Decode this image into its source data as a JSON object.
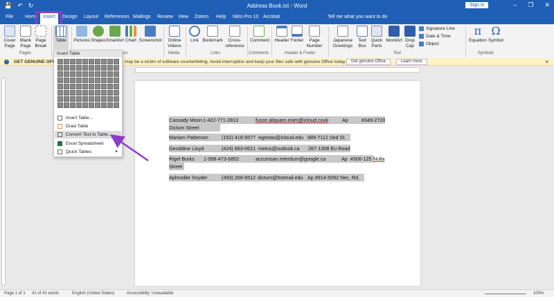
{
  "titlebar": {
    "doc_title": "Address Book.txt - Word",
    "signin": "Sign in",
    "minimize": "–",
    "restore": "❐",
    "close": "✕",
    "qat_save": "💾",
    "qat_undo": "↶",
    "qat_redo": "↻"
  },
  "tabs": [
    "File",
    "Home",
    "Insert",
    "Design",
    "Layout",
    "References",
    "Mailings",
    "Review",
    "View",
    "Zotero",
    "Help",
    "Nitro Pro 10",
    "Acrobat"
  ],
  "tell_me": "Tell me what you want to do",
  "ribbon": {
    "cover_page": "Cover Page",
    "blank_page": "Blank Page",
    "page_break": "Page Break",
    "table": "Table",
    "pictures": "Pictures",
    "shapes": "Shapes",
    "smartart": "SmartArt",
    "chart": "Chart",
    "screenshot": "Screenshot",
    "online_videos": "Online Videos",
    "link": "Link",
    "bookmark": "Bookmark",
    "cross_reference": "Cross-reference",
    "comment": "Comment",
    "header": "Header",
    "footer": "Footer",
    "page_number": "Page Number",
    "japanese_greetings": "Japanese Greetings",
    "text_box": "Text Box",
    "quick_parts": "Quick Parts",
    "wordart": "WordArt",
    "drop_cap": "Drop Cap",
    "signature_line": "Signature Line",
    "date_time": "Date & Time",
    "object": "Object",
    "equation": "Equation",
    "symbol": "Symbol",
    "group_pages": "Pages",
    "group_tables": "Ta",
    "group_illustrations": "ns",
    "group_media": "Media",
    "group_links": "Links",
    "group_comments": "Comments",
    "group_header_footer": "Header & Footer",
    "group_text": "Text",
    "group_symbols": "Symbols"
  },
  "notice": {
    "bold": "GET GENUINE OFFIC",
    "message": "may be a victim of software counterfeiting. Avoid interruption and keep your files safe with genuine Office today.",
    "btn_genuine": "Get genuine Office",
    "btn_learn": "Learn more",
    "close": "×"
  },
  "table_menu": {
    "header": "Insert Table",
    "items": [
      "Insert Table...",
      "Draw Table",
      "Convert Text to Table...",
      "Excel Spreadsheet",
      "Quick Tables"
    ],
    "submenu_arrow": "▸"
  },
  "document": {
    "rows": [
      {
        "name": "Cassady Moon",
        "phone": "1-422-771-2813",
        "email": "fusce.aliquam.enim@icloud.couk",
        "addr1": "Ap",
        "addr2": "#349-2720",
        "wrap": "Dictum Street"
      },
      {
        "name": "Mariam Patterson",
        "phone": "(152) 418-5577",
        "email": "egestas@icloud.edu",
        "addr1": "889-7112 Sed St."
      },
      {
        "name": "Geraldine Lloyd",
        "phone": "(424) 663-0621",
        "email": "metus@outlook.ca",
        "addr1": "267-1308 Eu Road"
      },
      {
        "name": "Rigel Burks",
        "phone": "1-998-473-6852",
        "email": "accumsan.interdum@google.ca",
        "addr1": "Ap",
        "addr2": "#306-125",
        "addr3": "Nulla",
        "wrap": "Street"
      },
      {
        "name": "Aphrodite Snyder",
        "phone": "(493) 268-6512",
        "email": "dictum@hotmail.edu",
        "addr1": "Ap #914-5092 Nec, Rd."
      }
    ]
  },
  "statusbar": {
    "page": "Page 1 of 1",
    "words": "41 of 41 words",
    "language": "English (United States)",
    "accessibility": "Accessibility: Unavailable",
    "zoom": "100%"
  },
  "colors": {
    "brand": "#1f5fb5",
    "annotation": "#8a3ec9",
    "notice_bg": "#fcf2c4"
  }
}
